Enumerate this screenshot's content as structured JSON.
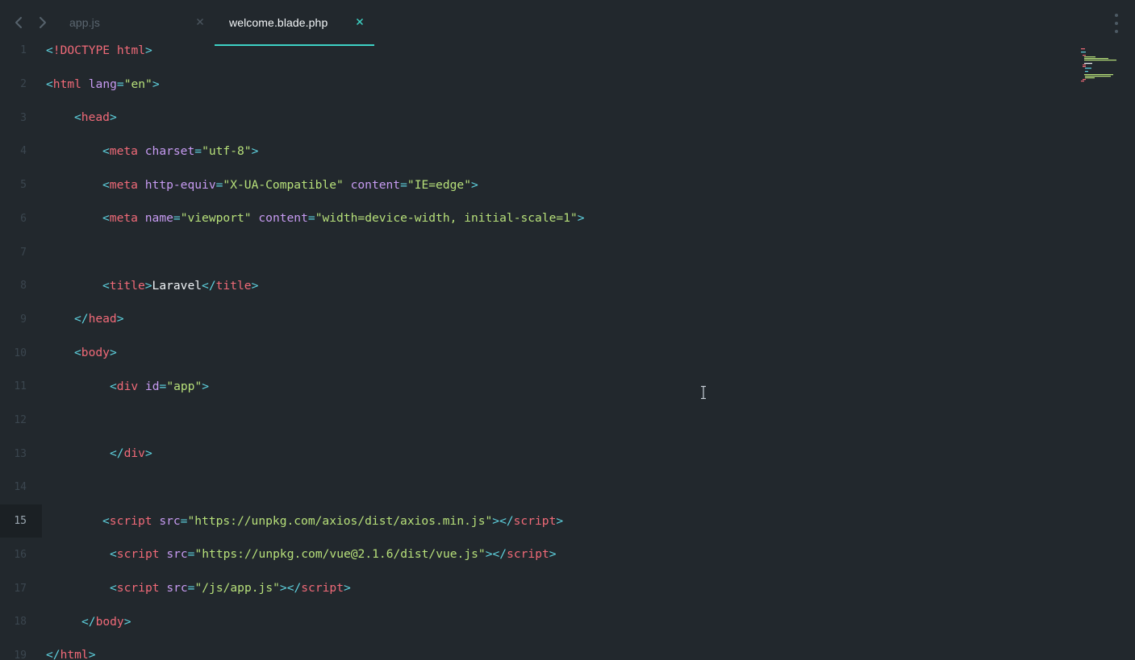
{
  "tabs": [
    {
      "label": "app.js",
      "active": false
    },
    {
      "label": "welcome.blade.php",
      "active": true
    }
  ],
  "theme": {
    "accent": "#3dd2c5",
    "background": "#22282d",
    "punctuation": "#5fd3e0",
    "tag": "#f06a78",
    "attribute": "#c79bf2",
    "string": "#b7e07a",
    "text": "#f0f4f7"
  },
  "editor": {
    "current_line": 15,
    "lines": [
      {
        "n": "1",
        "tokens": [
          [
            "punc",
            "<"
          ],
          [
            "tag",
            "!DOCTYPE html"
          ],
          [
            "punc",
            ">"
          ]
        ]
      },
      {
        "n": "2",
        "tokens": [
          [
            "punc",
            "<"
          ],
          [
            "tag",
            "html"
          ],
          [
            "text",
            " "
          ],
          [
            "attr",
            "lang"
          ],
          [
            "punc",
            "="
          ],
          [
            "str",
            "\"en\""
          ],
          [
            "punc",
            ">"
          ]
        ]
      },
      {
        "n": "3",
        "tokens": [
          [
            "punc",
            "<"
          ],
          [
            "tag",
            "head"
          ],
          [
            "punc",
            ">"
          ]
        ]
      },
      {
        "n": "4",
        "tokens": [
          [
            "punc",
            "<"
          ],
          [
            "tag",
            "meta"
          ],
          [
            "text",
            " "
          ],
          [
            "attr",
            "charset"
          ],
          [
            "punc",
            "="
          ],
          [
            "str",
            "\"utf-8\""
          ],
          [
            "punc",
            ">"
          ]
        ]
      },
      {
        "n": "5",
        "tokens": [
          [
            "punc",
            "<"
          ],
          [
            "tag",
            "meta"
          ],
          [
            "text",
            " "
          ],
          [
            "attr",
            "http-equiv"
          ],
          [
            "punc",
            "="
          ],
          [
            "str",
            "\"X-UA-Compatible\""
          ],
          [
            "text",
            " "
          ],
          [
            "attr",
            "content"
          ],
          [
            "punc",
            "="
          ],
          [
            "str",
            "\"IE=edge\""
          ],
          [
            "punc",
            ">"
          ]
        ]
      },
      {
        "n": "6",
        "tokens": [
          [
            "punc",
            "<"
          ],
          [
            "tag",
            "meta"
          ],
          [
            "text",
            " "
          ],
          [
            "attr",
            "name"
          ],
          [
            "punc",
            "="
          ],
          [
            "str",
            "\"viewport\""
          ],
          [
            "text",
            " "
          ],
          [
            "attr",
            "content"
          ],
          [
            "punc",
            "="
          ],
          [
            "str",
            "\"width=device-width, initial-scale=1\""
          ],
          [
            "punc",
            ">"
          ]
        ]
      },
      {
        "n": "7",
        "tokens": []
      },
      {
        "n": "8",
        "tokens": [
          [
            "punc",
            "<"
          ],
          [
            "tag",
            "title"
          ],
          [
            "punc",
            ">"
          ],
          [
            "text",
            "Laravel"
          ],
          [
            "punc",
            "</"
          ],
          [
            "tag",
            "title"
          ],
          [
            "punc",
            ">"
          ]
        ]
      },
      {
        "n": "9",
        "tokens": [
          [
            "punc",
            "</"
          ],
          [
            "tag",
            "head"
          ],
          [
            "punc",
            ">"
          ]
        ]
      },
      {
        "n": "10",
        "tokens": [
          [
            "punc",
            "<"
          ],
          [
            "tag",
            "body"
          ],
          [
            "punc",
            ">"
          ]
        ]
      },
      {
        "n": "11",
        "tokens": [
          [
            "punc",
            "<"
          ],
          [
            "tag",
            "div"
          ],
          [
            "text",
            " "
          ],
          [
            "attr",
            "id"
          ],
          [
            "punc",
            "="
          ],
          [
            "str",
            "\"app\""
          ],
          [
            "punc",
            ">"
          ]
        ]
      },
      {
        "n": "12",
        "tokens": []
      },
      {
        "n": "13",
        "tokens": [
          [
            "punc",
            "</"
          ],
          [
            "tag",
            "div"
          ],
          [
            "punc",
            ">"
          ]
        ]
      },
      {
        "n": "14",
        "tokens": []
      },
      {
        "n": "15",
        "tokens": [
          [
            "punc",
            "<"
          ],
          [
            "tag",
            "script"
          ],
          [
            "text",
            " "
          ],
          [
            "attr",
            "src"
          ],
          [
            "punc",
            "="
          ],
          [
            "str",
            "\"https://unpkg.com/axios/dist/axios.min.js\""
          ],
          [
            "punc",
            "></"
          ],
          [
            "tag",
            "script"
          ],
          [
            "punc",
            ">"
          ]
        ]
      },
      {
        "n": "16",
        "tokens": [
          [
            "punc",
            "<"
          ],
          [
            "tag",
            "script"
          ],
          [
            "text",
            " "
          ],
          [
            "attr",
            "src"
          ],
          [
            "punc",
            "="
          ],
          [
            "str",
            "\"https://unpkg.com/vue@2.1.6/dist/vue.js\""
          ],
          [
            "punc",
            "></"
          ],
          [
            "tag",
            "script"
          ],
          [
            "punc",
            ">"
          ]
        ]
      },
      {
        "n": "17",
        "tokens": [
          [
            "punc",
            "<"
          ],
          [
            "tag",
            "script"
          ],
          [
            "text",
            " "
          ],
          [
            "attr",
            "src"
          ],
          [
            "punc",
            "="
          ],
          [
            "str",
            "\"/js/app.js\""
          ],
          [
            "punc",
            "></"
          ],
          [
            "tag",
            "script"
          ],
          [
            "punc",
            ">"
          ]
        ]
      },
      {
        "n": "18",
        "tokens": [
          [
            "punc",
            "</"
          ],
          [
            "tag",
            "body"
          ],
          [
            "punc",
            ">"
          ]
        ]
      },
      {
        "n": "19",
        "tokens": [
          [
            "punc",
            "</"
          ],
          [
            "tag",
            "html"
          ],
          [
            "punc",
            ">"
          ]
        ]
      }
    ]
  },
  "icons": {
    "back": "chevron-left-icon",
    "forward": "chevron-right-icon",
    "close": "close-icon",
    "more": "more-vertical-icon",
    "cursor": "text-cursor-icon"
  }
}
